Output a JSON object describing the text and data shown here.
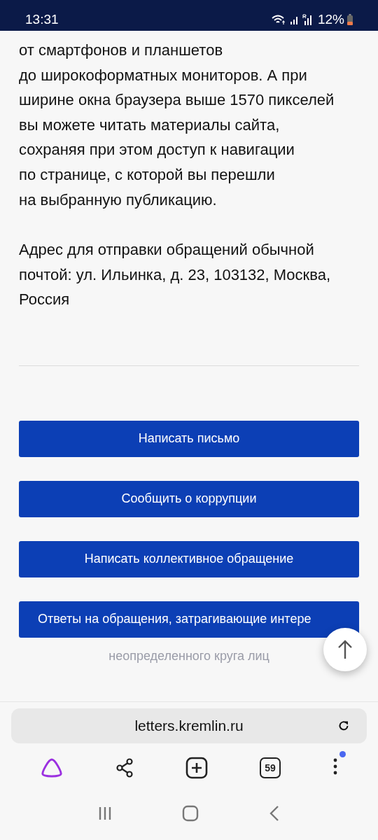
{
  "status_bar": {
    "time": "13:31",
    "battery": "12%"
  },
  "paragraphs": [
    {
      "lines": [
        "от смартфонов и планшетов",
        "до широкоформатных мониторов. А при",
        "ширине окна браузера выше 1570 пикселей",
        "вы можете читать материалы сайта,",
        "сохраняя при этом доступ к навигации",
        "по странице, с которой вы перешли",
        "на выбранную публикацию."
      ]
    },
    {
      "lines": [
        "Адрес для отправки обращений обычной",
        "почтой: ул. Ильинка, д. 23, 103132, Москва,",
        "Россия"
      ]
    }
  ],
  "buttons": [
    {
      "label": "Написать письмо"
    },
    {
      "label": "Сообщить о коррупции"
    },
    {
      "label": "Написать коллективное обращение"
    },
    {
      "label": "Ответы на обращения, затрагивающие интере",
      "overflow": "неопределенного круга лиц"
    }
  ],
  "browser": {
    "url": "letters.kremlin.ru",
    "tabs_count": "59",
    "menu_badge": true
  }
}
